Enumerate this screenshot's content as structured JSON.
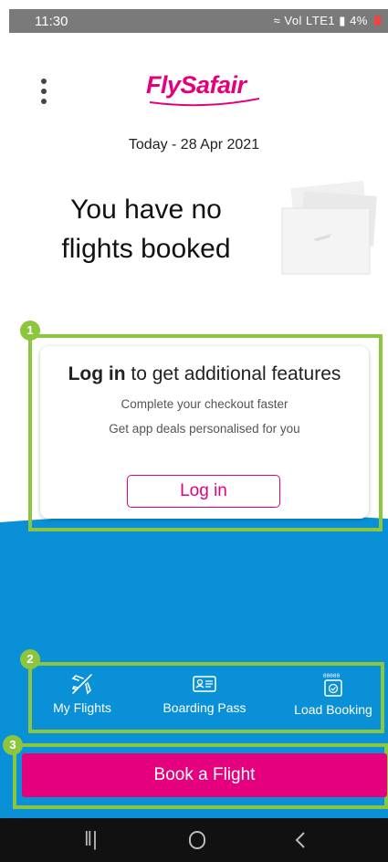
{
  "status_bar": {
    "time": "11:30",
    "network": "Vol LTE1",
    "battery": "4%"
  },
  "header": {
    "logo_text_fly": "Fly",
    "logo_text_safair": "Safair",
    "date": "Today - 28 Apr 2021"
  },
  "main": {
    "no_flights": "You have no flights booked"
  },
  "login_card": {
    "headline_bold": "Log in",
    "headline_rest": " to get additional features",
    "line1": "Complete your checkout faster",
    "line2": "Get app deals personalised for you",
    "button_label": "Log in"
  },
  "nav": {
    "items": [
      {
        "label": "My Flights",
        "icon": "plane-icon"
      },
      {
        "label": "Boarding Pass",
        "icon": "boarding-pass-icon"
      },
      {
        "label": "Load Booking",
        "icon": "load-booking-icon"
      }
    ]
  },
  "cta": {
    "book_label": "Book a Flight"
  },
  "callouts": [
    "1",
    "2",
    "3"
  ],
  "colors": {
    "brand_pink": "#e4007c",
    "sky_blue": "#0a90d6",
    "callout_green": "#8cc63f"
  }
}
